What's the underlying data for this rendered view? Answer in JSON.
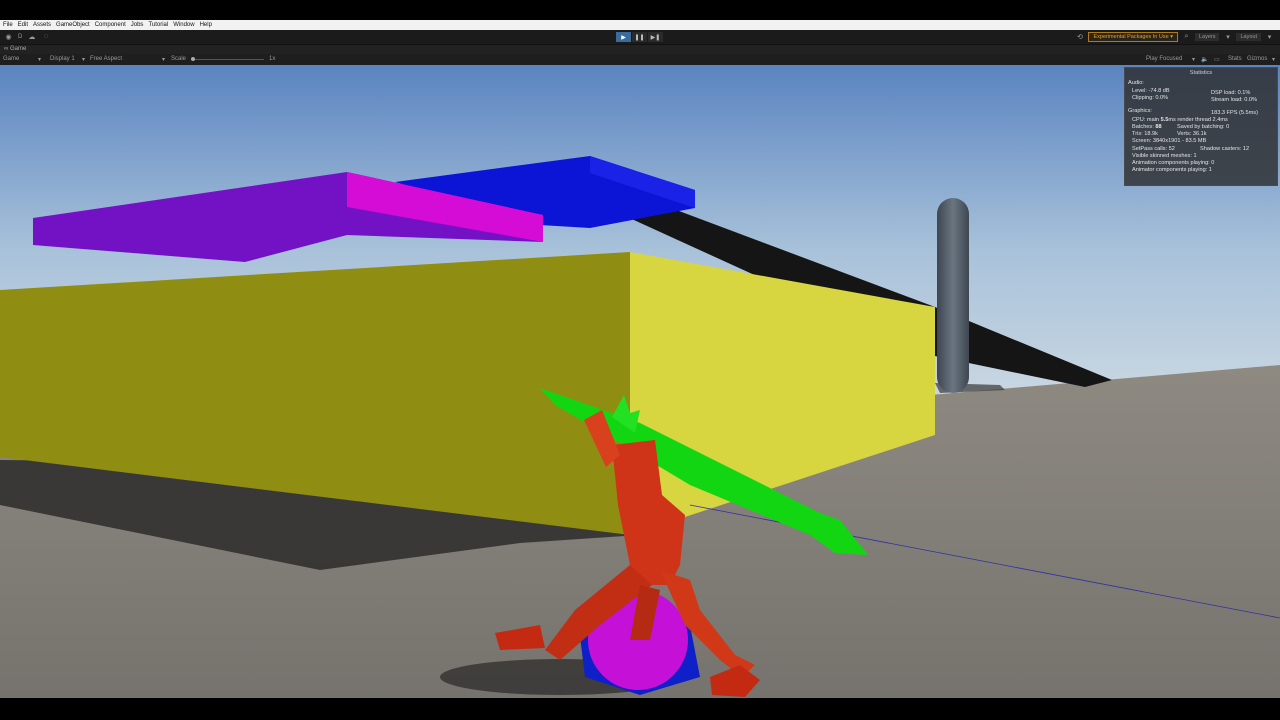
{
  "menu": [
    "File",
    "Edit",
    "Assets",
    "GameObject",
    "Component",
    "Jobs",
    "Tutorial",
    "Window",
    "Help"
  ],
  "toolbar": {
    "account_initial": "D",
    "experimental_label": "Experimental Packages In Use ▾",
    "layers_label": "Layers",
    "layout_label": "Layout",
    "play_icon": "▶",
    "pause_icon": "❚❚",
    "step_icon": "▶❚"
  },
  "tab": {
    "label": "Game"
  },
  "gamebar": {
    "view_select": "Game",
    "display_select": "Display 1",
    "aspect_select": "Free Aspect",
    "scale_label": "Scale",
    "scale_value": "1x",
    "play_mode": "Play Focused",
    "stats_label": "Stats",
    "gizmos_label": "Gizmos"
  },
  "stats": {
    "title": "Statistics",
    "audio_header": "Audio:",
    "level": "Level: -74.8 dB",
    "clipping": "Clipping: 0.0%",
    "dsp_load": "DSP load: 0.1%",
    "stream_load": "Stream load: 0.0%",
    "graphics_header": "Graphics:",
    "fps": "183.3 FPS (5.5ms)",
    "cpu_prefix": "CPU: main ",
    "cpu_main": "5.5",
    "cpu_suffix": "ms  render thread 2.4ms",
    "batches_prefix": "Batches: ",
    "batches_value": "88",
    "saved_batching": "Saved by batching: 0",
    "tris": "Tris: 18.9k",
    "verts": "Verts: 36.1k",
    "screen": "Screen: 3840x1901 - 83.5 MB",
    "setpass": "SetPass calls: 52",
    "shadow_casters": "Shadow casters: 12",
    "skinned": "Visible skinned meshes: 1",
    "animation": "Animation components playing: 0",
    "animator": "Animator components playing: 1"
  },
  "colors": {
    "sky_top": "#5e88c2",
    "sky_bottom": "#c6d6e4",
    "ground": "#7d7a74",
    "yellow_face": "#8f8f12",
    "yellow_side": "#d8d640",
    "magenta": "#d60cd6",
    "purple": "#7a10c8",
    "blue": "#0c16d8",
    "green": "#10d810",
    "character": "#d0361a",
    "accent": "#3a6b9c"
  }
}
